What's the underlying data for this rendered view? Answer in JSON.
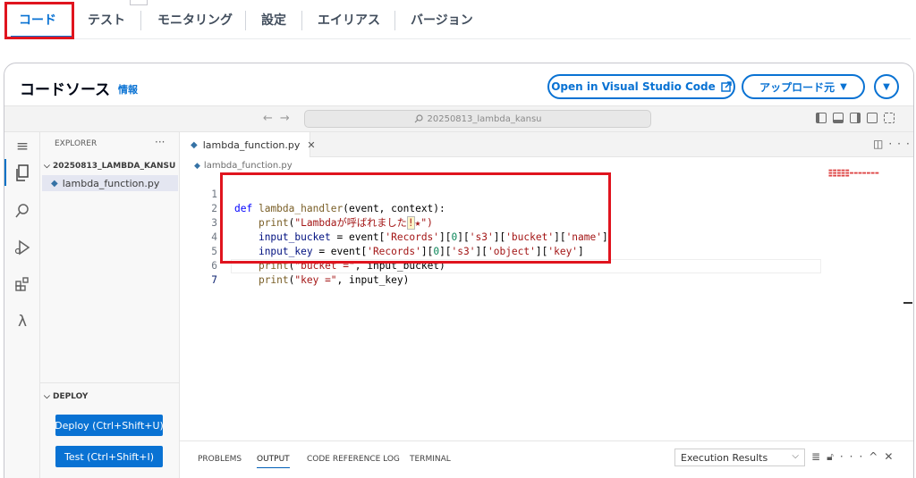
{
  "tabs": [
    {
      "label": "コード",
      "active": true
    },
    {
      "label": "テスト"
    },
    {
      "label": "モニタリング"
    },
    {
      "label": "設定"
    },
    {
      "label": "エイリアス"
    },
    {
      "label": "バージョン"
    }
  ],
  "panel": {
    "title": "コードソース",
    "info": "情報",
    "open_vscode_label": "Open in Visual Studio Code",
    "upload_label": "アップロード元"
  },
  "editor": {
    "search_text": "20250813_lambda_kansu",
    "explorer_title": "EXPLORER",
    "folder_name": "20250813_LAMBDA_KANSU",
    "file_name": "lambda_function.py",
    "tab_label": "lambda_function.py",
    "breadcrumb": "lambda_function.py",
    "deploy_title": "DEPLOY",
    "deploy_button": "Deploy (Ctrl+Shift+U)",
    "test_button": "Test (Ctrl+Shift+I)"
  },
  "code": {
    "line_numbers": [
      "1",
      "2",
      "3",
      "4",
      "5",
      "6",
      "7"
    ],
    "l1": {
      "kw": "def",
      "fn": "lambda_handler",
      "rest": "(event, context):"
    },
    "l2": {
      "fn": "print",
      "open": "(",
      "str": "\"Lambdaが呼ばれました",
      "bang": "!",
      "tail": "★\")"
    },
    "l3": {
      "var": "input_bucket",
      "mid": " = event[",
      "s1": "'Records'",
      "b1": "][",
      "n": "0",
      "b2": "][",
      "s2": "'s3'",
      "b3": "][",
      "s3": "'bucket'",
      "b4": "][",
      "s4": "'name'",
      "end": "]"
    },
    "l4": {
      "var": "input_key",
      "mid": " = event[",
      "s1": "'Records'",
      "b1": "][",
      "n": "0",
      "b2": "][",
      "s2": "'s3'",
      "b3": "][",
      "s3": "'object'",
      "b4": "][",
      "s4": "'key'",
      "end": "]"
    },
    "l5": {
      "fn": "print",
      "open": "(",
      "str": "\"bucket =\"",
      "rest": ", input_bucket)"
    },
    "l6": {
      "fn": "print",
      "open": "(",
      "str": "\"key =\"",
      "rest": ", input_key)"
    }
  },
  "bottom_panel": {
    "tabs": [
      "PROBLEMS",
      "OUTPUT",
      "CODE REFERENCE LOG",
      "TERMINAL"
    ],
    "active_tab": "OUTPUT",
    "select_value": "Execution Results"
  },
  "colors": {
    "accent": "#0972d3",
    "highlight_red": "#e0141e"
  }
}
